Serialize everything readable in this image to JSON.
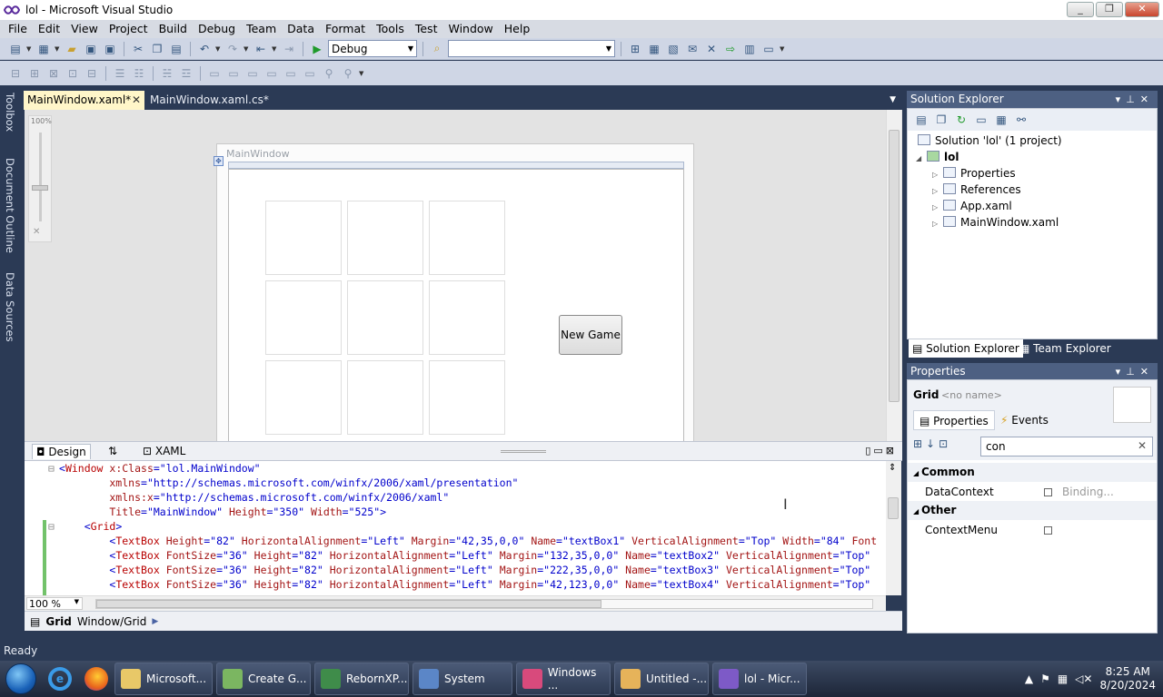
{
  "window": {
    "title": "lol - Microsoft Visual Studio",
    "min": "_",
    "max": "❐",
    "close": "✕"
  },
  "menu": [
    "File",
    "Edit",
    "View",
    "Project",
    "Build",
    "Debug",
    "Team",
    "Data",
    "Format",
    "Tools",
    "Test",
    "Window",
    "Help"
  ],
  "toolbar": {
    "config": "Debug",
    "platform": ""
  },
  "left_tabs": [
    "Toolbox",
    "Document Outline",
    "Data Sources"
  ],
  "doc_tabs": [
    {
      "label": "MainWindow.xaml*",
      "close": "✕"
    },
    {
      "label": "MainWindow.xaml.cs*"
    }
  ],
  "designer": {
    "zoom_label": "100%",
    "window_title": "MainWindow",
    "new_game_button": "New Game"
  },
  "split_tabs": {
    "design": "Design",
    "swap": "⇅",
    "xaml": "XAML"
  },
  "code_lines": [
    {
      "t": [
        [
          "t-b",
          "<"
        ],
        [
          "t-k",
          "Window"
        ],
        [
          "t-r",
          " x:Class"
        ],
        [
          "t-b",
          "=\"lol.MainWindow\""
        ]
      ]
    },
    {
      "t": [
        [
          "t-r",
          "        xmlns"
        ],
        [
          "t-b",
          "=\"http://schemas.microsoft.com/winfx/2006/xaml/presentation\""
        ]
      ]
    },
    {
      "t": [
        [
          "t-r",
          "        xmlns:x"
        ],
        [
          "t-b",
          "=\"http://schemas.microsoft.com/winfx/2006/xaml\""
        ]
      ]
    },
    {
      "t": [
        [
          "t-r",
          "        Title"
        ],
        [
          "t-b",
          "=\"MainWindow\""
        ],
        [
          "t-r",
          " Height"
        ],
        [
          "t-b",
          "=\"350\""
        ],
        [
          "t-r",
          " Width"
        ],
        [
          "t-b",
          "=\"525\">"
        ]
      ]
    },
    {
      "t": [
        [
          "t-b",
          "    <"
        ],
        [
          "t-k",
          "Grid"
        ],
        [
          "t-b",
          ">"
        ]
      ]
    },
    {
      "t": [
        [
          "t-b",
          "        <"
        ],
        [
          "t-k",
          "TextBox"
        ],
        [
          "t-r",
          " Height"
        ],
        [
          "t-b",
          "=\"82\""
        ],
        [
          "t-r",
          " HorizontalAlignment"
        ],
        [
          "t-b",
          "=\"Left\""
        ],
        [
          "t-r",
          " Margin"
        ],
        [
          "t-b",
          "=\"42,35,0,0\""
        ],
        [
          "t-r",
          " Name"
        ],
        [
          "t-b",
          "=\"textBox1\""
        ],
        [
          "t-r",
          " VerticalAlignment"
        ],
        [
          "t-b",
          "=\"Top\""
        ],
        [
          "t-r",
          " Width"
        ],
        [
          "t-b",
          "=\"84\""
        ],
        [
          "t-r",
          " Font"
        ]
      ]
    },
    {
      "t": [
        [
          "t-b",
          "        <"
        ],
        [
          "t-k",
          "TextBox"
        ],
        [
          "t-r",
          " FontSize"
        ],
        [
          "t-b",
          "=\"36\""
        ],
        [
          "t-r",
          " Height"
        ],
        [
          "t-b",
          "=\"82\""
        ],
        [
          "t-r",
          " HorizontalAlignment"
        ],
        [
          "t-b",
          "=\"Left\""
        ],
        [
          "t-r",
          " Margin"
        ],
        [
          "t-b",
          "=\"132,35,0,0\""
        ],
        [
          "t-r",
          " Name"
        ],
        [
          "t-b",
          "=\"textBox2\""
        ],
        [
          "t-r",
          " VerticalAlignment"
        ],
        [
          "t-b",
          "=\"Top\""
        ]
      ]
    },
    {
      "t": [
        [
          "t-b",
          "        <"
        ],
        [
          "t-k",
          "TextBox"
        ],
        [
          "t-r",
          " FontSize"
        ],
        [
          "t-b",
          "=\"36\""
        ],
        [
          "t-r",
          " Height"
        ],
        [
          "t-b",
          "=\"82\""
        ],
        [
          "t-r",
          " HorizontalAlignment"
        ],
        [
          "t-b",
          "=\"Left\""
        ],
        [
          "t-r",
          " Margin"
        ],
        [
          "t-b",
          "=\"222,35,0,0\""
        ],
        [
          "t-r",
          " Name"
        ],
        [
          "t-b",
          "=\"textBox3\""
        ],
        [
          "t-r",
          " VerticalAlignment"
        ],
        [
          "t-b",
          "=\"Top\""
        ]
      ]
    },
    {
      "t": [
        [
          "t-b",
          "        <"
        ],
        [
          "t-k",
          "TextBox"
        ],
        [
          "t-r",
          " FontSize"
        ],
        [
          "t-b",
          "=\"36\""
        ],
        [
          "t-r",
          " Height"
        ],
        [
          "t-b",
          "=\"82\""
        ],
        [
          "t-r",
          " HorizontalAlignment"
        ],
        [
          "t-b",
          "=\"Left\""
        ],
        [
          "t-r",
          " Margin"
        ],
        [
          "t-b",
          "=\"42,123,0,0\""
        ],
        [
          "t-r",
          " Name"
        ],
        [
          "t-b",
          "=\"textBox4\""
        ],
        [
          "t-r",
          " VerticalAlignment"
        ],
        [
          "t-b",
          "=\"Top\""
        ]
      ]
    }
  ],
  "code_zoom": "100 %",
  "breadcrumb": {
    "grid": "Grid",
    "path": "Window/Grid"
  },
  "status": "Ready",
  "solution_explorer": {
    "title": "Solution Explorer",
    "items": [
      {
        "label": "Solution 'lol' (1 project)"
      },
      {
        "label": "lol"
      },
      {
        "label": "Properties"
      },
      {
        "label": "References"
      },
      {
        "label": "App.xaml"
      },
      {
        "label": "MainWindow.xaml"
      }
    ],
    "tabs": [
      "Solution Explorer",
      "Team Explorer"
    ]
  },
  "properties": {
    "title": "Properties",
    "object": "Grid",
    "name_placeholder": "<no name>",
    "tab_props": "Properties",
    "tab_events": "Events",
    "search": "con",
    "cat_common": "Common",
    "cat_other": "Other",
    "rows": [
      {
        "name": "DataContext",
        "value": "Binding..."
      },
      {
        "name": "ContextMenu",
        "value": ""
      }
    ]
  },
  "taskbar": {
    "tasks": [
      {
        "label": "Microsoft...",
        "color": "#e8c868"
      },
      {
        "label": "Create G...",
        "color": "#7bb661"
      },
      {
        "label": "RebornXP...",
        "color": "#3f8c4a"
      },
      {
        "label": "System",
        "color": "#5b86c7"
      },
      {
        "label": "Windows ...",
        "color": "#d84a7c"
      },
      {
        "label": "Untitled -...",
        "color": "#e6b35a"
      },
      {
        "label": "lol - Micr...",
        "color": "#7d5ac7"
      }
    ],
    "time": "8:25 AM",
    "date": "8/20/2024"
  }
}
